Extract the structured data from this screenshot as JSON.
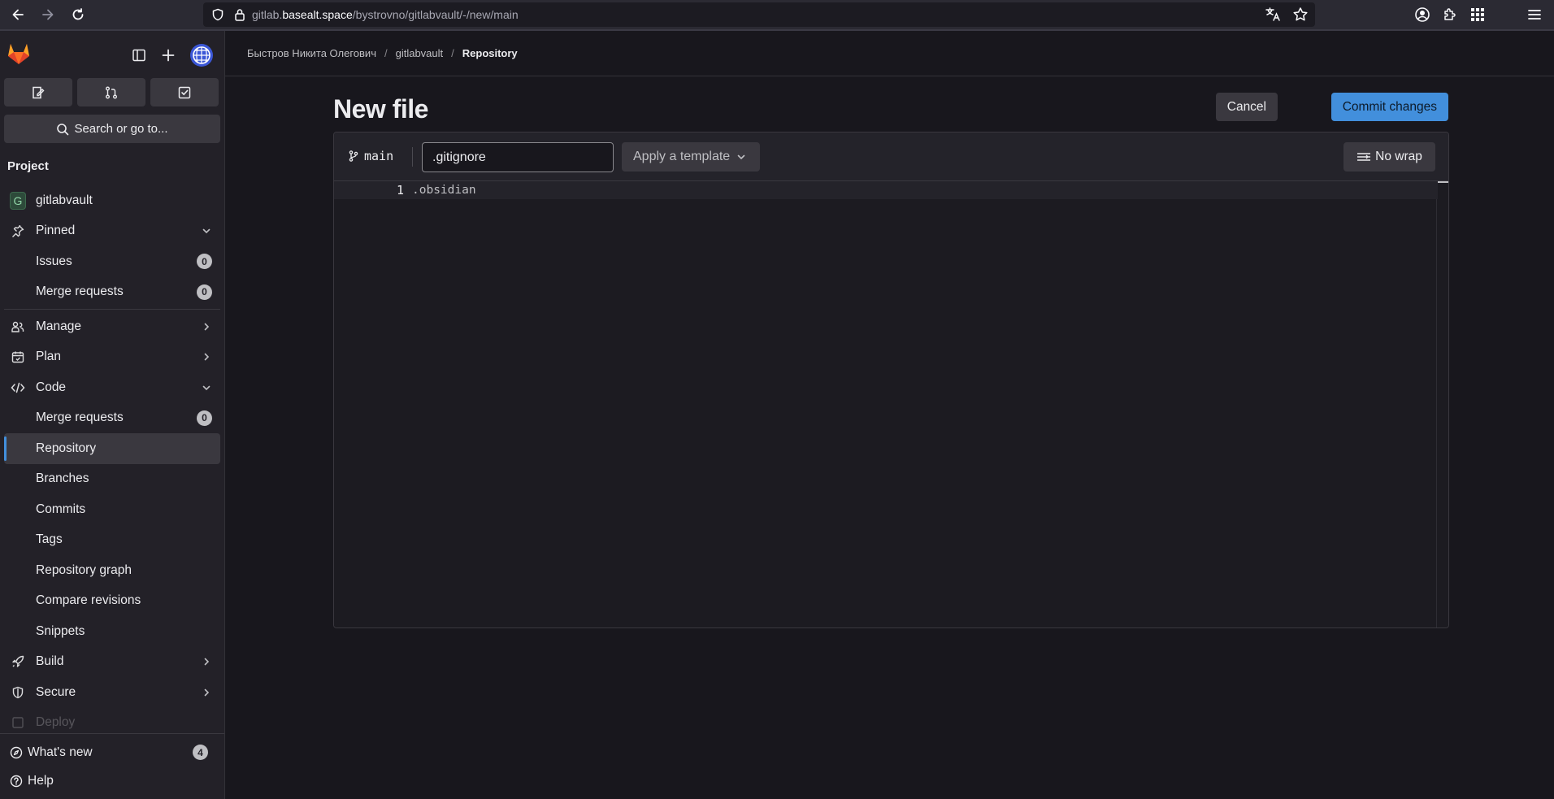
{
  "browser": {
    "url_prefix": "gitlab.",
    "url_host": "basealt.space",
    "url_path": "/bystrovno/gitlabvault/-/new/main"
  },
  "sidebar": {
    "search_label": "Search or go to...",
    "section_title": "Project",
    "project_avatar_letter": "G",
    "project_name": "gitlabvault",
    "items": [
      {
        "label": "Pinned"
      },
      {
        "label": "Issues",
        "badge": "0"
      },
      {
        "label": "Merge requests",
        "badge": "0"
      },
      {
        "label": "Manage"
      },
      {
        "label": "Plan"
      },
      {
        "label": "Code"
      },
      {
        "label": "Merge requests",
        "badge": "0"
      },
      {
        "label": "Repository"
      },
      {
        "label": "Branches"
      },
      {
        "label": "Commits"
      },
      {
        "label": "Tags"
      },
      {
        "label": "Repository graph"
      },
      {
        "label": "Compare revisions"
      },
      {
        "label": "Snippets"
      },
      {
        "label": "Build"
      },
      {
        "label": "Secure"
      },
      {
        "label": "Deploy"
      }
    ],
    "whats_new_label": "What's new",
    "whats_new_count": "4",
    "help_label": "Help"
  },
  "breadcrumb": {
    "user": "Быстров Никита Олегович",
    "project": "gitlabvault",
    "current": "Repository"
  },
  "page": {
    "title": "New file",
    "cancel_label": "Cancel",
    "commit_label": "Commit changes"
  },
  "editor": {
    "branch": "main",
    "filename": ".gitignore",
    "template_label": "Apply a template",
    "nowrap_label": "No wrap",
    "lines": [
      {
        "number": "1",
        "text": ".obsidian"
      }
    ]
  },
  "colors": {
    "accent": "#428fdc",
    "background": "#18171d",
    "sidebar": "#232128"
  }
}
